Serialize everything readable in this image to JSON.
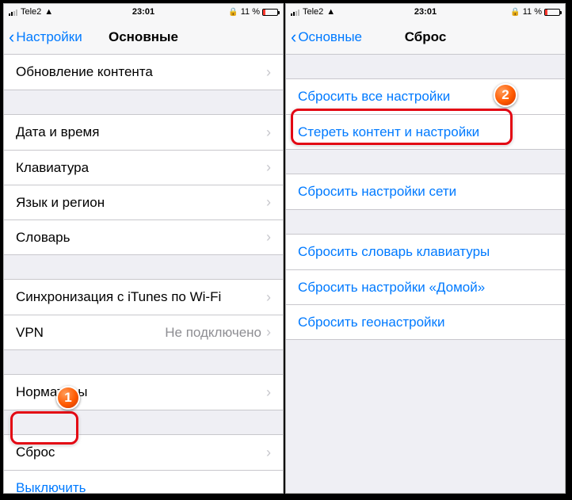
{
  "status": {
    "carrier": "Tele2",
    "time": "23:01",
    "battery_pct": "11 %"
  },
  "left": {
    "back_label": "Настройки",
    "title": "Основные",
    "rows": {
      "update": "Обновление контента",
      "datetime": "Дата и время",
      "keyboard": "Клавиатура",
      "lang": "Язык и регион",
      "dict": "Словарь",
      "itunes": "Синхронизация с iTunes по Wi-Fi",
      "vpn": "VPN",
      "vpn_value": "Не подключено",
      "norm": "Нормативы",
      "reset": "Сброс",
      "shutdown": "Выключить"
    }
  },
  "right": {
    "back_label": "Основные",
    "title": "Сброс",
    "rows": {
      "reset_all": "Сбросить все настройки",
      "erase": "Стереть контент и настройки",
      "reset_net": "Сбросить настройки сети",
      "reset_kb": "Сбросить словарь клавиатуры",
      "reset_home": "Сбросить настройки «Домой»",
      "reset_geo": "Сбросить геонастройки"
    }
  },
  "annotations": {
    "badge1": "1",
    "badge2": "2"
  }
}
